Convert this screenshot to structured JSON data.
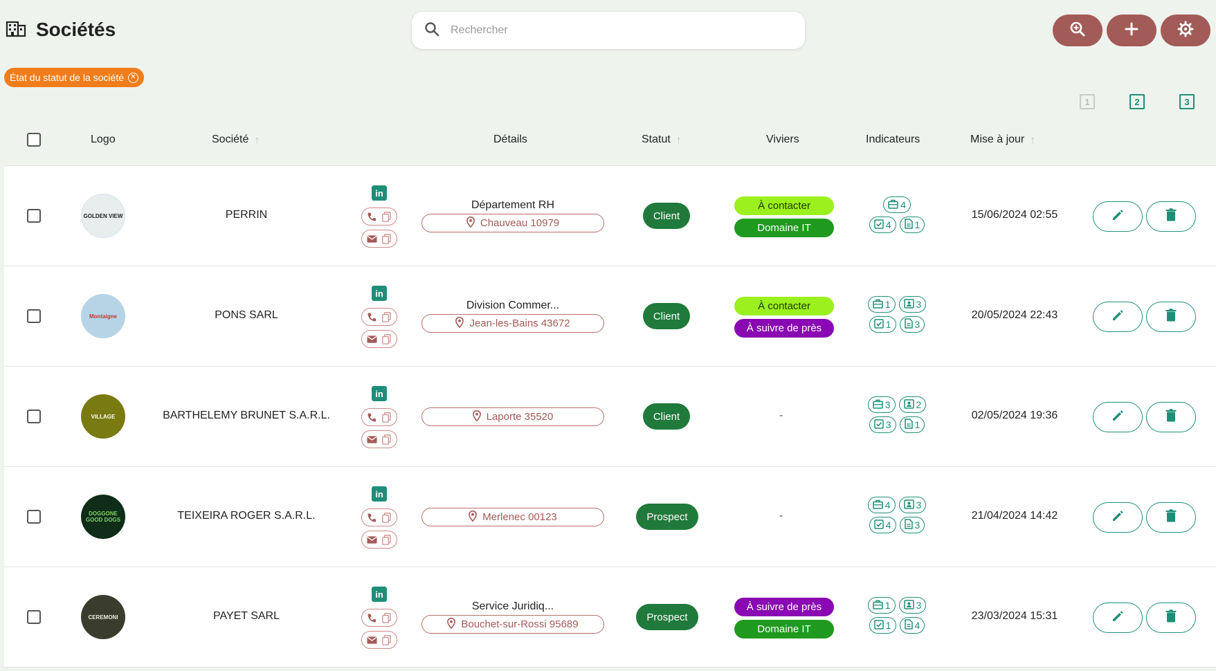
{
  "header": {
    "title": "Sociétés",
    "search_placeholder": "Rechercher"
  },
  "filter_chip": {
    "label": "État du statut de la société"
  },
  "view_options": [
    "1",
    "2",
    "3"
  ],
  "columns": {
    "logo": "Logo",
    "company": "Société",
    "details": "Détails",
    "status": "Statut",
    "viviers": "Viviers",
    "indicators": "Indicateurs",
    "updated": "Mise à jour"
  },
  "colors": {
    "accent": "#1d8f79",
    "brand_button": "#a25b57",
    "chip": "#ef7d1b",
    "status_bg": "#1f7a3b",
    "tag_a_contacter": "#9cf01e",
    "tag_domaine_it": "#1f9a1f",
    "tag_suivre": "#8a08b3"
  },
  "rows": [
    {
      "company": "PERRIN",
      "logo_text": "GOLDEN VIEW",
      "detail_title": "Département RH",
      "location": "Chauveau 10979",
      "status": "Client",
      "viviers": [
        {
          "label": "À contacter",
          "kind": "a_contacter"
        },
        {
          "label": "Domaine IT",
          "kind": "domaine_it"
        }
      ],
      "indicators": {
        "line1": [
          {
            "icon": "briefcase",
            "value": "4"
          }
        ],
        "line2": [
          {
            "icon": "check",
            "value": "4"
          },
          {
            "icon": "doc",
            "value": "1"
          }
        ]
      },
      "updated": "15/06/2024 02:55"
    },
    {
      "company": "PONS SARL",
      "logo_text": "Montaigne",
      "detail_title": "Division Commer...",
      "location": "Jean-les-Bains 43672",
      "status": "Client",
      "viviers": [
        {
          "label": "À contacter",
          "kind": "a_contacter"
        },
        {
          "label": "À suivre de près",
          "kind": "suivre"
        }
      ],
      "indicators": {
        "line1": [
          {
            "icon": "briefcase",
            "value": "1"
          },
          {
            "icon": "contact",
            "value": "3"
          }
        ],
        "line2": [
          {
            "icon": "check",
            "value": "1"
          },
          {
            "icon": "doc",
            "value": "3"
          }
        ]
      },
      "updated": "20/05/2024 22:43"
    },
    {
      "company": "BARTHELEMY BRUNET S.A.R.L.",
      "logo_text": "VILLAGE",
      "detail_title": "",
      "location": "Laporte 35520",
      "status": "Client",
      "viviers": [],
      "viviers_empty": "-",
      "indicators": {
        "line1": [
          {
            "icon": "briefcase",
            "value": "3"
          },
          {
            "icon": "contact",
            "value": "2"
          }
        ],
        "line2": [
          {
            "icon": "check",
            "value": "3"
          },
          {
            "icon": "doc",
            "value": "1"
          }
        ]
      },
      "updated": "02/05/2024 19:36"
    },
    {
      "company": "TEIXEIRA ROGER S.A.R.L.",
      "logo_text": "DOGGONE GOOD DOGS",
      "detail_title": "",
      "location": "Merlenec 00123",
      "status": "Prospect",
      "viviers": [],
      "viviers_empty": "-",
      "indicators": {
        "line1": [
          {
            "icon": "briefcase",
            "value": "4"
          },
          {
            "icon": "contact",
            "value": "3"
          }
        ],
        "line2": [
          {
            "icon": "check",
            "value": "4"
          },
          {
            "icon": "doc",
            "value": "3"
          }
        ]
      },
      "updated": "21/04/2024 14:42"
    },
    {
      "company": "PAYET SARL",
      "logo_text": "CEREMONI",
      "detail_title": "Service Juridiq...",
      "location": "Bouchet-sur-Rossi 95689",
      "status": "Prospect",
      "viviers": [
        {
          "label": "À suivre de près",
          "kind": "suivre"
        },
        {
          "label": "Domaine IT",
          "kind": "domaine_it"
        }
      ],
      "indicators": {
        "line1": [
          {
            "icon": "briefcase",
            "value": "1"
          },
          {
            "icon": "contact",
            "value": "3"
          }
        ],
        "line2": [
          {
            "icon": "check",
            "value": "1"
          },
          {
            "icon": "doc",
            "value": "4"
          }
        ]
      },
      "updated": "23/03/2024 15:31"
    }
  ]
}
